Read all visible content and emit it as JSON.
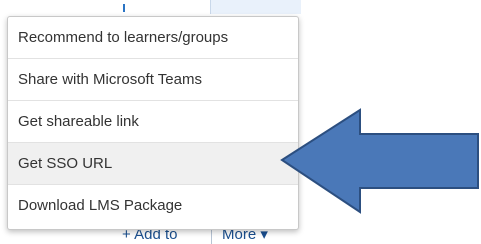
{
  "menu": {
    "items": [
      {
        "label": "Recommend to learners/groups"
      },
      {
        "label": "Share with Microsoft Teams"
      },
      {
        "label": "Get shareable link"
      },
      {
        "label": "Get SSO URL"
      },
      {
        "label": "Download LMS Package"
      }
    ],
    "highlighted_index": 3
  },
  "bottom_bar": {
    "add_label": "+ Add to",
    "more_label": "More ▾"
  },
  "colors": {
    "arrow_fill": "#4a78b8",
    "arrow_stroke": "#2c4f80",
    "link": "#1a4f8f",
    "highlight": "#f0f0f0"
  }
}
